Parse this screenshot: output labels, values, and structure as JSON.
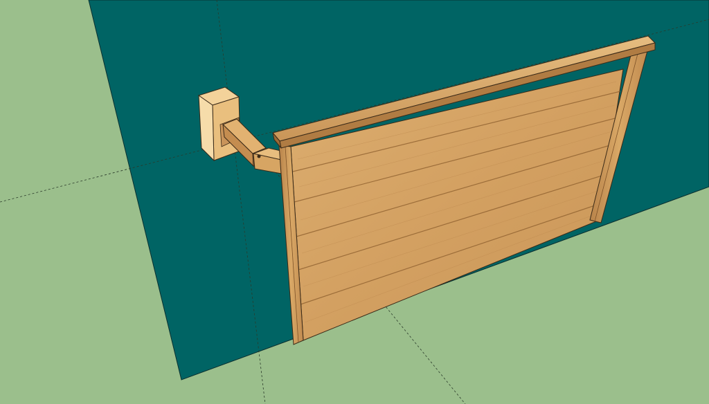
{
  "app": {
    "type": "3d-modeling-viewport",
    "visible_text": []
  },
  "scene": {
    "ground_color": "#9bbf8c",
    "wall_color": "#006464",
    "wood_light": "#e0b574",
    "wood_mid": "#cf9b5a",
    "wood_dark": "#a87640",
    "bracket_color": "#f0c98a",
    "axis_line_color": "#2a3a2a",
    "objects": [
      "ground-plane",
      "wall-panel",
      "wall-bracket",
      "swing-arm",
      "wooden-board",
      "board-top-rail",
      "board-side-post-left",
      "board-side-post-right"
    ]
  }
}
